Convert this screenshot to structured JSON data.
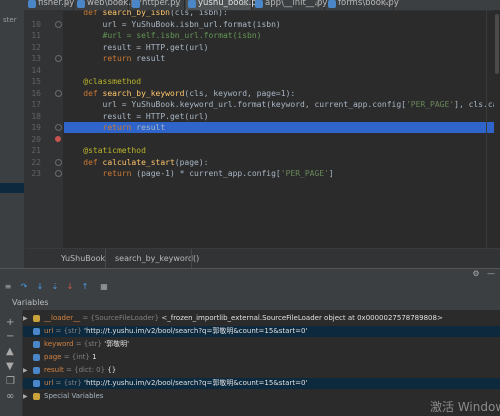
{
  "tabs": [
    {
      "label": "fisher.py"
    },
    {
      "label": "web\\book.py"
    },
    {
      "label": "httper.py"
    },
    {
      "label": "yushu_book.py"
    },
    {
      "label": "app\\__init__.py"
    },
    {
      "label": "forms\\book.py"
    }
  ],
  "left_strip_label": "ster",
  "editor": {
    "line_numbers": [
      "",
      "10",
      "11",
      "12",
      "13",
      "14",
      "15",
      "16",
      "17",
      "18",
      "19",
      "20",
      "21",
      "22",
      "23"
    ],
    "lines": [
      {
        "parts": [
          {
            "t": "    def ",
            "c": "kw"
          },
          {
            "t": "search_by_isbn",
            "c": "fn"
          },
          {
            "t": "(cls, isbn):",
            "c": ""
          }
        ]
      },
      {
        "parts": [
          {
            "t": "        url = YuShuBook.isbn_url.format(isbn)",
            "c": ""
          }
        ]
      },
      {
        "parts": [
          {
            "t": "        #url = self.isbn_url.format(isbn)",
            "c": "cm"
          }
        ]
      },
      {
        "parts": [
          {
            "t": "        result = HTTP.get(url)",
            "c": ""
          }
        ]
      },
      {
        "parts": [
          {
            "t": "        ",
            "c": ""
          },
          {
            "t": "return",
            "c": "kw"
          },
          {
            "t": " result",
            "c": ""
          }
        ]
      },
      {
        "parts": [
          {
            "t": "",
            "c": ""
          }
        ]
      },
      {
        "parts": [
          {
            "t": "    @classmethod",
            "c": "dec"
          }
        ]
      },
      {
        "parts": [
          {
            "t": "    ",
            "c": ""
          },
          {
            "t": "def ",
            "c": "kw"
          },
          {
            "t": "search_by_keyword",
            "c": "fn"
          },
          {
            "t": "(cls, keyword, page=1):",
            "c": ""
          }
        ]
      },
      {
        "parts": [
          {
            "t": "        url = YuShuBook.keyword_url.format(keyword, current_app.config[",
            "c": ""
          },
          {
            "t": "'PER_PAGE'",
            "c": "str"
          },
          {
            "t": "], cls.calculate_start(page))",
            "c": ""
          }
        ]
      },
      {
        "parts": [
          {
            "t": "        result = HTTP.get(url)",
            "c": ""
          }
        ]
      },
      {
        "parts": [
          {
            "t": "        ",
            "c": ""
          },
          {
            "t": "return",
            "c": "kw"
          },
          {
            "t": " result",
            "c": ""
          }
        ]
      },
      {
        "parts": [
          {
            "t": "",
            "c": ""
          }
        ]
      },
      {
        "parts": [
          {
            "t": "    @staticmethod",
            "c": "dec"
          }
        ]
      },
      {
        "parts": [
          {
            "t": "    ",
            "c": ""
          },
          {
            "t": "def ",
            "c": "kw"
          },
          {
            "t": "calculate_start",
            "c": "fn"
          },
          {
            "t": "(page):",
            "c": ""
          }
        ]
      },
      {
        "parts": [
          {
            "t": "        ",
            "c": ""
          },
          {
            "t": "return",
            "c": "kw"
          },
          {
            "t": " (page-1) * current_app.config[",
            "c": ""
          },
          {
            "t": "'PER_PAGE'",
            "c": "str"
          },
          {
            "t": "]",
            "c": ""
          }
        ]
      }
    ]
  },
  "breadcrumb": {
    "class_name": "YuShuBook",
    "method_name": "search_by_keyword()"
  },
  "variables": {
    "title": "Variables",
    "rows": [
      {
        "arrow": "▶",
        "icon_color": "#c9a23c",
        "name": "__loader__",
        "type": "= {SourceFileLoader}",
        "value": "<_frozen_importlib_external.SourceFileLoader object at 0x0000027578789808>",
        "selected": false
      },
      {
        "arrow": "",
        "icon_color": "#4a86c8",
        "name": "url",
        "type": "= {str}",
        "value": "'http://t.yushu.im/v2/bool/search?q=郭敬明&count=15&start=0'",
        "selected": true
      },
      {
        "arrow": "",
        "icon_color": "#4a86c8",
        "name": "keyword",
        "type": "= {str}",
        "value": "'郭敬明'",
        "selected": false
      },
      {
        "arrow": "",
        "icon_color": "#4a86c8",
        "name": "page",
        "type": "= {int}",
        "value": "1",
        "selected": false
      },
      {
        "arrow": "▶",
        "icon_color": "#4a86c8",
        "name": "result",
        "type": "= {dict: 0}",
        "value": "{}",
        "selected": false
      },
      {
        "arrow": "",
        "icon_color": "#4a86c8",
        "name": "url",
        "type": "= {str}",
        "value": "'http://t.yushu.im/v2/bool/search?q=郭敬明&count=15&start=0'",
        "selected": true
      },
      {
        "arrow": "▶",
        "icon_color": "#c9a23c",
        "name": "Special Variables",
        "type": "",
        "value": "",
        "selected": false
      }
    ]
  },
  "toolbar_icons": [
    "step-over-icon",
    "step-into-icon",
    "step-into-my-code-icon",
    "force-step-into-icon",
    "step-out-icon",
    "run-to-cursor-icon",
    "evaluate-icon"
  ],
  "watermark": "激活 Window"
}
